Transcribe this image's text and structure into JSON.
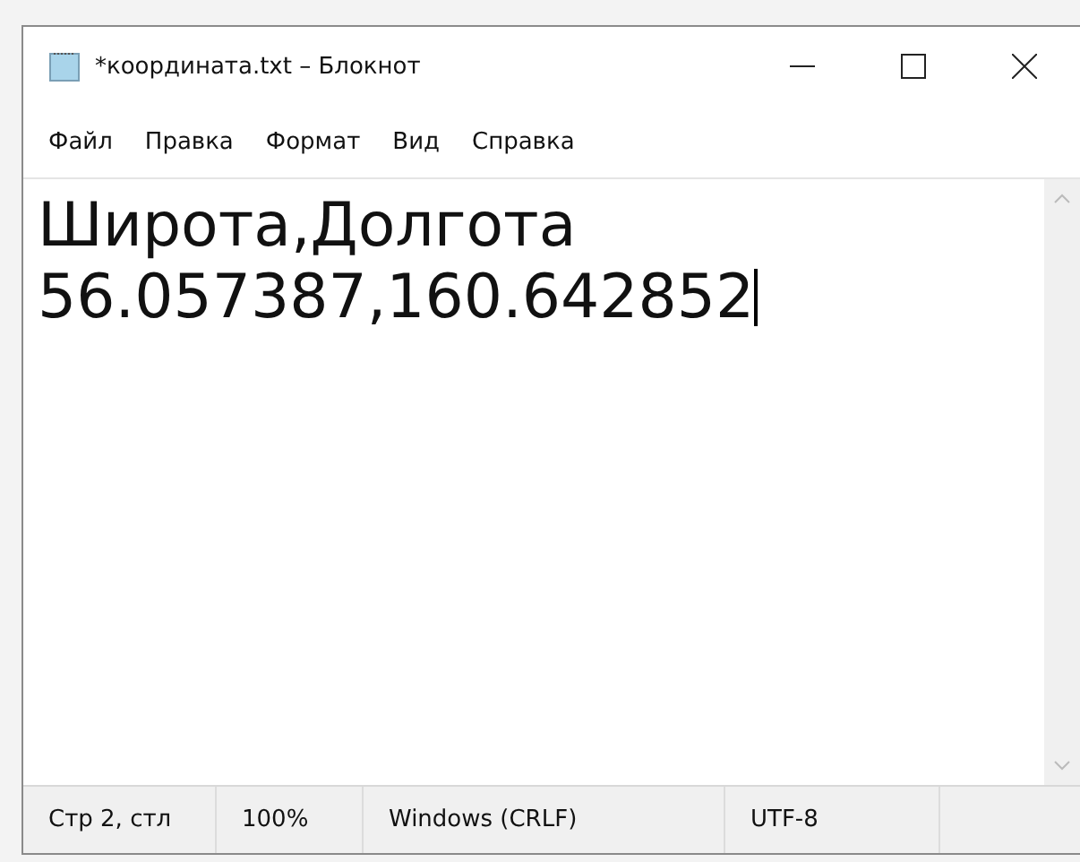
{
  "window": {
    "title": "*координата.txt – Блокнот"
  },
  "menu": [
    "Файл",
    "Правка",
    "Формат",
    "Вид",
    "Справка"
  ],
  "editor": {
    "lines": [
      "Широта,Долгота",
      "56.057387,160.642852"
    ]
  },
  "status_bar": [
    "Стр 2, стл",
    "100%",
    "Windows (CRLF)",
    "UTF-8"
  ]
}
